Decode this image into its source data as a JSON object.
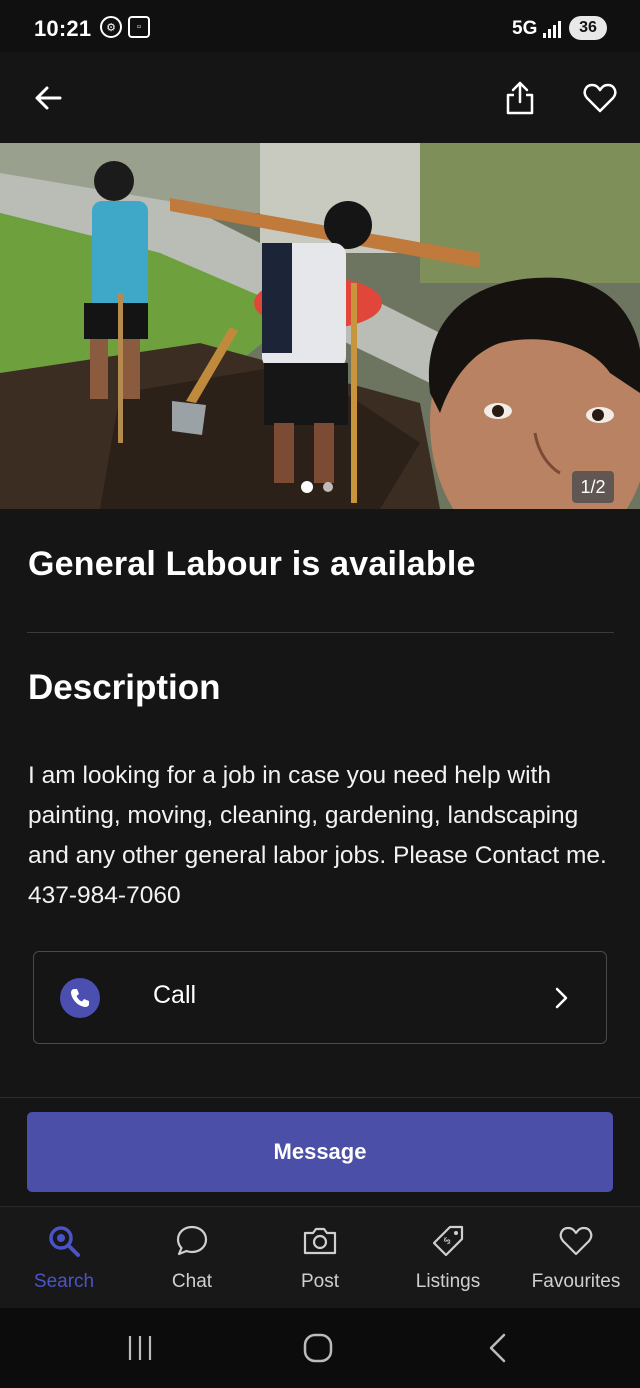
{
  "status_bar": {
    "time": "10:21",
    "network": "5G",
    "battery": "36"
  },
  "header": {
    "back_icon": "arrow-left-icon",
    "share_icon": "share-icon",
    "favourite_icon": "heart-icon"
  },
  "gallery": {
    "counter": "1/2",
    "current_index": 1,
    "total": 2
  },
  "listing": {
    "title": "General Labour is available",
    "description_heading": "Description",
    "description": "I am looking for a job in case you need help with painting, moving, cleaning, gardening, landscaping and any other general labor jobs. Please Contact me. 437-984-7060"
  },
  "call": {
    "label": "Call",
    "icon": "phone-icon"
  },
  "message_button": {
    "label": "Message"
  },
  "bottom_nav": {
    "items": [
      {
        "label": "Search",
        "icon": "search-icon",
        "active": true
      },
      {
        "label": "Chat",
        "icon": "chat-bubble-icon",
        "active": false
      },
      {
        "label": "Post",
        "icon": "camera-icon",
        "active": false
      },
      {
        "label": "Listings",
        "icon": "price-tag-icon",
        "active": false
      },
      {
        "label": "Favourites",
        "icon": "heart-icon",
        "active": false
      }
    ]
  },
  "colors": {
    "accent": "#4b4fa8",
    "active_nav": "#4a54c8",
    "background": "#151515"
  }
}
